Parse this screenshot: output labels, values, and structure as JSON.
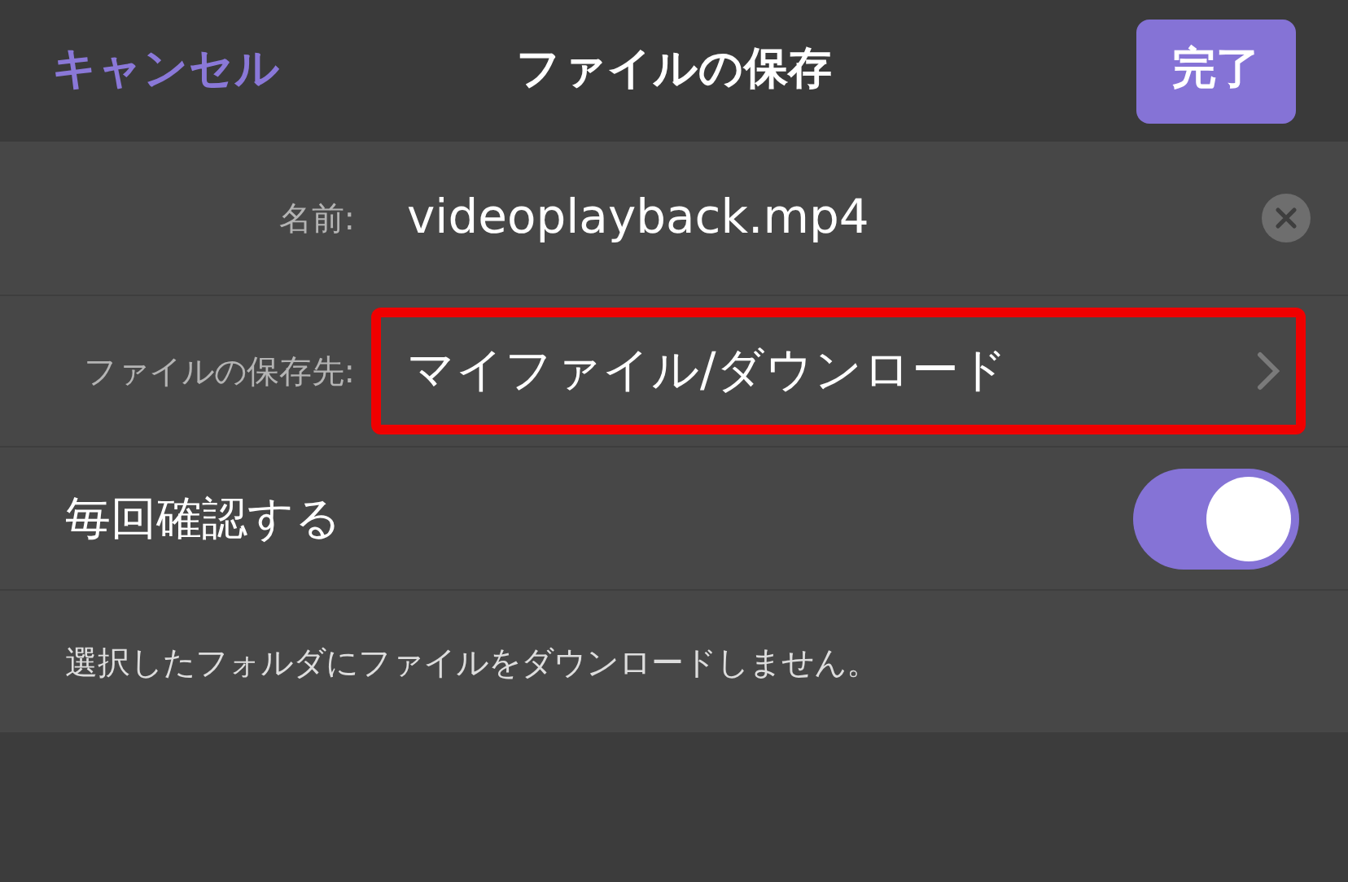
{
  "header": {
    "cancel": "キャンセル",
    "title": "ファイルの保存",
    "done": "完了"
  },
  "name_row": {
    "label": "名前:",
    "value": "videoplayback.mp4"
  },
  "location_row": {
    "label": "ファイルの保存先:",
    "value": "マイファイル/ダウンロード",
    "highlighted": true
  },
  "toggle_row": {
    "label": "毎回確認する",
    "on": true
  },
  "note": "選択したフォルダにファイルをダウンロードしません。"
}
